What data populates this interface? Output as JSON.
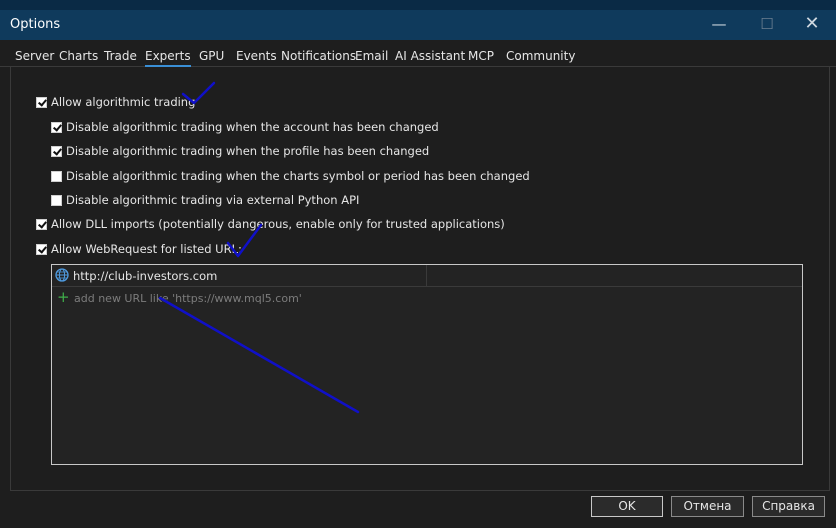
{
  "window": {
    "title": "Options"
  },
  "tabs": [
    {
      "label": "Server"
    },
    {
      "label": "Charts"
    },
    {
      "label": "Trade"
    },
    {
      "label": "Experts",
      "active": true
    },
    {
      "label": "GPU"
    },
    {
      "label": "Events"
    },
    {
      "label": "Notifications"
    },
    {
      "label": "Email"
    },
    {
      "label": "AI Assistant"
    },
    {
      "label": "MCP"
    },
    {
      "label": "Community"
    }
  ],
  "experts": {
    "allow_algo": {
      "label": "Allow algorithmic trading",
      "checked": true
    },
    "disable_account": {
      "label": "Disable algorithmic trading when the account has been changed",
      "checked": true
    },
    "disable_profile": {
      "label": "Disable algorithmic trading when the profile has been changed",
      "checked": true
    },
    "disable_symbol": {
      "label": "Disable algorithmic trading when the charts symbol or period has been changed",
      "checked": false
    },
    "disable_python": {
      "label": "Disable algorithmic trading via external Python API",
      "checked": false
    },
    "allow_dll": {
      "label": "Allow DLL imports (potentially dangerous, enable only for trusted applications)",
      "checked": true
    },
    "allow_webrequest": {
      "label": "Allow WebRequest for listed URL:",
      "checked": true
    }
  },
  "url_list": {
    "items": [
      {
        "url": "http://club-investors.com",
        "icon": "globe-icon"
      }
    ],
    "add_placeholder": "add new URL like 'https://www.mql5.com'",
    "add_icon": "plus-icon"
  },
  "buttons": {
    "ok": "OK",
    "cancel": "Отмена",
    "help": "Справка"
  },
  "colors": {
    "titlebar": "#0f3a5c",
    "accent": "#3a8fd6",
    "annotation": "#1010c8",
    "add": "#3fae4a"
  }
}
